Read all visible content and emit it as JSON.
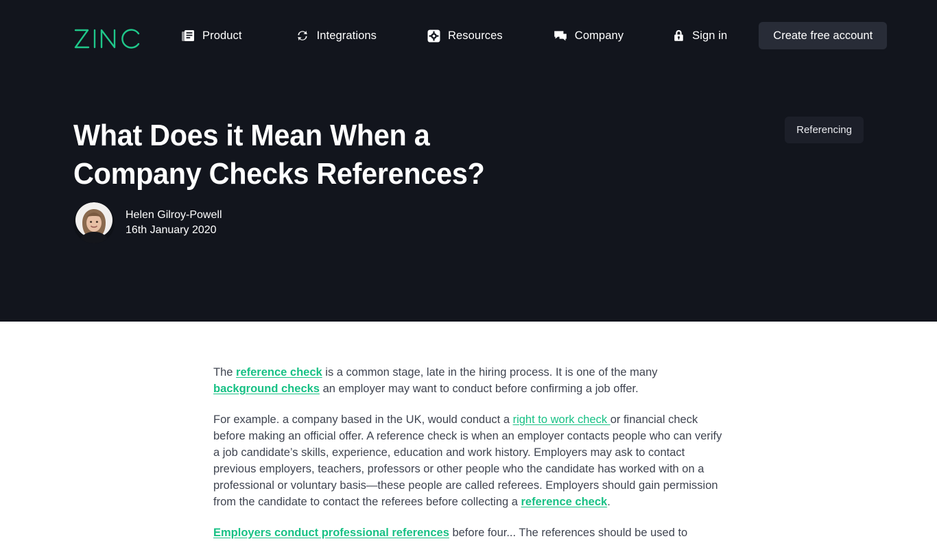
{
  "brand": {
    "logo_text": "ZINC",
    "logo_color": "#1fc78a",
    "accent_color": "#18c185",
    "hero_bg": "#12151d",
    "cta_bg": "#282c37",
    "badge_bg": "#1c1f29",
    "body_text_color": "#3f4450"
  },
  "nav": {
    "items": [
      {
        "label": "Product",
        "icon": "article-icon"
      },
      {
        "label": "Integrations",
        "icon": "sync-icon"
      },
      {
        "label": "Resources",
        "icon": "gear-square-icon"
      },
      {
        "label": "Company",
        "icon": "chat-icon"
      },
      {
        "label": "Sign in",
        "icon": "lock-icon"
      }
    ],
    "cta_label": "Create free account"
  },
  "hero": {
    "headline": "What Does it Mean When a Company Checks References?",
    "category_label": "Referencing",
    "author_name": "Helen Gilroy-Powell",
    "published_date": "16th January 2020"
  },
  "article": {
    "paragraphs": [
      {
        "id": "p1",
        "parts": [
          {
            "type": "text",
            "text": "The "
          },
          {
            "type": "link",
            "text": "reference check",
            "bold": true
          },
          {
            "type": "text",
            "text": " is a common stage, late in the hiring process. It is one of the many "
          },
          {
            "type": "link",
            "text": "background checks",
            "bold": true
          },
          {
            "type": "text",
            "text": " an employer may want to conduct before confirming a job offer."
          }
        ]
      },
      {
        "id": "p2",
        "parts": [
          {
            "type": "text",
            "text": "For example. a company based in the UK, would conduct a "
          },
          {
            "type": "link",
            "text": "right to work check ",
            "bold": false
          },
          {
            "type": "text",
            "text": "or financial check before making an official offer. A reference check is when an employer contacts people who can verify a job candidate’s skills, experience, education and work history. Employers may ask to contact previous employers, teachers, professors or other people who the candidate has worked with on a professional or voluntary basis—these people are called referees. Employers should gain permission from the candidate to contact the referees before collecting a "
          },
          {
            "type": "link",
            "text": "reference check",
            "bold": true
          },
          {
            "type": "text",
            "text": "."
          }
        ]
      },
      {
        "id": "p3",
        "parts": [
          {
            "type": "link",
            "text": "Employers conduct professional references",
            "bold": true
          },
          {
            "type": "text",
            "text": " before four... The references should be used to"
          }
        ]
      }
    ]
  }
}
